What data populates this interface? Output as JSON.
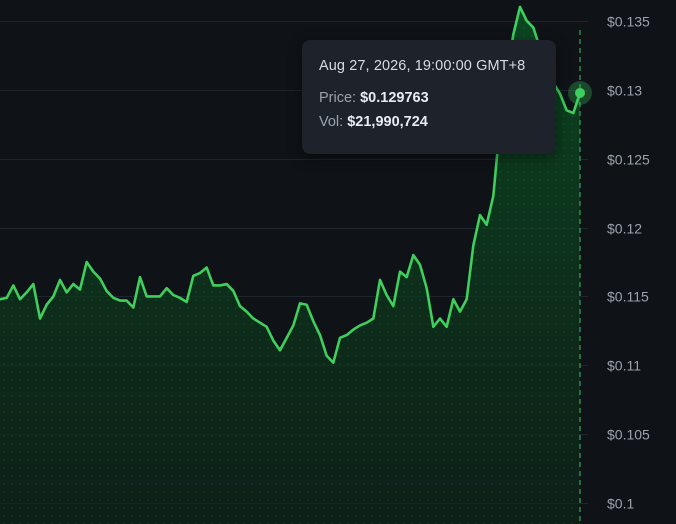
{
  "chart_data": {
    "type": "area",
    "y_ticks": [
      0.1,
      0.105,
      0.11,
      0.115,
      0.12,
      0.125,
      0.13,
      0.135
    ],
    "y_tick_labels": [
      "$0.1",
      "$0.105",
      "$0.11",
      "$0.115",
      "$0.12",
      "$0.125",
      "$0.13",
      "$0.135"
    ],
    "ylim": [
      0.0985,
      0.1365
    ],
    "grid": true,
    "colors": {
      "line": "#3ecf5c",
      "area": "#0a3a1c",
      "crosshair": "#2f9e4a",
      "background": "#0f1217"
    },
    "series": [
      {
        "values": [
          0.1148,
          0.1149,
          0.1158,
          0.1148,
          0.1153,
          0.1159,
          0.1134,
          0.1144,
          0.115,
          0.1162,
          0.1153,
          0.1159,
          0.1155,
          0.1175,
          0.1168,
          0.1163,
          0.1154,
          0.1149,
          0.1147,
          0.1147,
          0.1142,
          0.1164,
          0.115,
          0.115,
          0.115,
          0.1156,
          0.1151,
          0.1149,
          0.1146,
          0.1165,
          0.1167,
          0.1171,
          0.1158,
          0.1158,
          0.1159,
          0.1154,
          0.1143,
          0.1139,
          0.1134,
          0.1131,
          0.1128,
          0.1118,
          0.1111,
          0.112,
          0.1129,
          0.1145,
          0.1144,
          0.1132,
          0.1122,
          0.1107,
          0.1102,
          0.112,
          0.1122,
          0.1126,
          0.1129,
          0.1131,
          0.1134,
          0.1162,
          0.1151,
          0.1143,
          0.1168,
          0.1164,
          0.118,
          0.1173,
          0.1156,
          0.1128,
          0.1134,
          0.1128,
          0.1148,
          0.1139,
          0.1148,
          0.1187,
          0.1209,
          0.1202,
          0.1223,
          0.1275,
          0.131,
          0.134,
          0.136,
          0.135,
          0.1345,
          0.133,
          0.131,
          0.1305,
          0.1297,
          0.1285,
          0.1283,
          0.12976
        ]
      }
    ],
    "tooltip": {
      "date": "Aug 27, 2026, 19:00:00 GMT+8",
      "price_label": "Price:",
      "price_value": "$0.129763",
      "vol_label": "Vol:",
      "vol_value": "$21,990,724"
    },
    "highlight_index": 87
  }
}
